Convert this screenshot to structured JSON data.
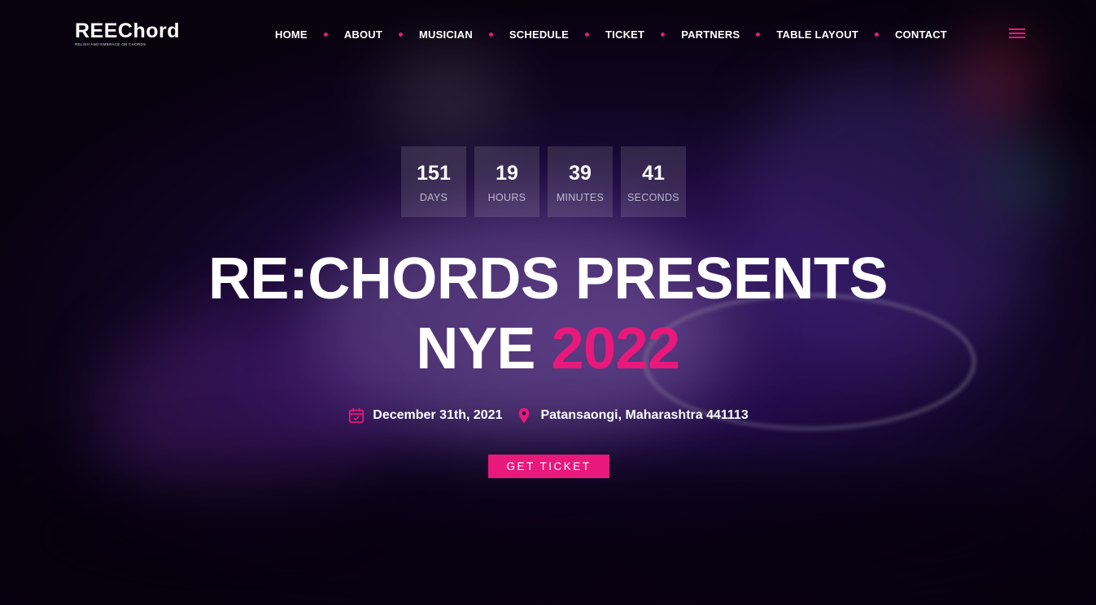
{
  "brand": {
    "logo_text": "REEChord",
    "tagline": "RELISH AND EMBRACE ON CHORDS"
  },
  "nav": {
    "items": [
      {
        "label": "HOME"
      },
      {
        "label": "ABOUT"
      },
      {
        "label": "MUSICIAN"
      },
      {
        "label": "SCHEDULE"
      },
      {
        "label": "TICKET"
      },
      {
        "label": "PARTNERS"
      },
      {
        "label": "TABLE LAYOUT"
      },
      {
        "label": "CONTACT"
      }
    ],
    "menu_icon": "hamburger-icon"
  },
  "countdown": {
    "days": {
      "value": "151",
      "label": "DAYS"
    },
    "hours": {
      "value": "19",
      "label": "HOURS"
    },
    "minutes": {
      "value": "39",
      "label": "MINUTES"
    },
    "seconds": {
      "value": "41",
      "label": "SECONDS"
    }
  },
  "hero": {
    "title_line1": "RE:CHORDS PRESENTS",
    "title_line2_prefix": "NYE",
    "title_line2_accent": "2022"
  },
  "event": {
    "date": "December 31th, 2021",
    "location": "Patansaongi, Maharashtra 441113",
    "date_icon": "calendar-icon",
    "location_icon": "map-pin-icon"
  },
  "cta": {
    "label": "GET TICKET"
  },
  "colors": {
    "accent": "#e9187b",
    "text": "#ffffff"
  }
}
